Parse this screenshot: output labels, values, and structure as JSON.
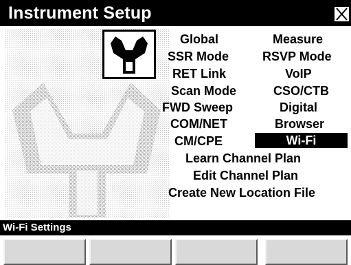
{
  "window": {
    "title": "Instrument Setup"
  },
  "icons": {
    "close": "close-icon",
    "setup": "wrench-icon"
  },
  "menu": {
    "items": [
      {
        "label": "Global"
      },
      {
        "label": "Measure"
      },
      {
        "label": "SSR Mode"
      },
      {
        "label": "RSVP Mode"
      },
      {
        "label": "RET Link"
      },
      {
        "label": "VoIP"
      },
      {
        "label": "Scan Mode"
      },
      {
        "label": "CSO/CTB"
      },
      {
        "label": "FWD Sweep"
      },
      {
        "label": "Digital"
      },
      {
        "label": "COM/NET"
      },
      {
        "label": "Browser"
      },
      {
        "label": "CM/CPE"
      },
      {
        "label": "Wi-Fi",
        "selected": true
      },
      {
        "label": "Learn Channel Plan"
      },
      {
        "label": "Edit Channel Plan"
      },
      {
        "label": "Create New Location File"
      }
    ]
  },
  "status": {
    "text": "Wi-Fi Settings"
  },
  "softkeys": [
    {
      "label": ""
    },
    {
      "label": ""
    },
    {
      "label": ""
    },
    {
      "label": ""
    }
  ],
  "colors": {
    "bar": "#000000",
    "background": "#ffffff",
    "softkey": "#d9d9d9",
    "selected_bg": "#000000",
    "selected_fg": "#ffffff"
  }
}
